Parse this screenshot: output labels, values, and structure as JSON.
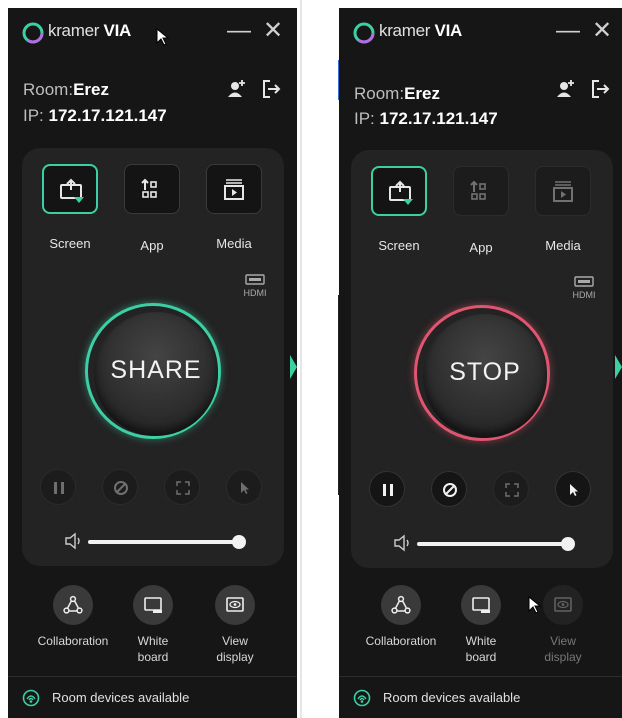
{
  "app": {
    "brand_light": "kramer",
    "brand_bold": "VIA"
  },
  "colors": {
    "accent": "#3dcfa4",
    "stop_ring": "#e0556f",
    "panel_bg": "#161616",
    "card_bg": "#232323"
  },
  "icons": {
    "logo": "kramer-logo-icon",
    "minimize": "minimize-icon",
    "close": "close-icon",
    "add_user": "add-user-icon",
    "exit": "exit-icon",
    "screen": "screen-share-icon",
    "app": "app-grid-icon",
    "media": "media-icon",
    "hdmi": "hdmi-icon",
    "pause": "pause-icon",
    "block": "block-icon",
    "fullscreen": "fullscreen-icon",
    "pointer": "pointer-icon",
    "volume": "volume-icon",
    "collaboration": "collaboration-icon",
    "whiteboard": "whiteboard-icon",
    "view_display": "view-display-icon",
    "room_devices": "room-devices-icon",
    "expand": "expand-arrow-icon"
  },
  "panels": [
    {
      "window_controls": {
        "minimize": "—",
        "close": "✕"
      },
      "room_label": "Room:",
      "room_name": "Erez",
      "ip_label": "IP: ",
      "ip": "172.17.121.147",
      "sources": {
        "screen": "Screen",
        "app": "App",
        "media": "Media"
      },
      "hdmi_label": "HDMI",
      "main_button": "SHARE",
      "volume_level": 0.95,
      "bottom": {
        "collaboration": "Collaboration",
        "whiteboard_line1": "White",
        "whiteboard_line2": "board",
        "view_line1": "View",
        "view_line2": "display"
      },
      "footer": "Room devices available"
    },
    {
      "window_controls": {
        "minimize": "—",
        "close": "✕"
      },
      "room_label": "Room:",
      "room_name": "Erez",
      "ip_label": "IP: ",
      "ip": "172.17.121.147",
      "sources": {
        "screen": "Screen",
        "app": "App",
        "media": "Media"
      },
      "hdmi_label": "HDMI",
      "main_button": "STOP",
      "volume_level": 0.95,
      "bottom": {
        "collaboration": "Collaboration",
        "whiteboard_line1": "White",
        "whiteboard_line2": "board",
        "view_line1": "View",
        "view_line2": "display"
      },
      "footer": "Room devices available"
    }
  ]
}
